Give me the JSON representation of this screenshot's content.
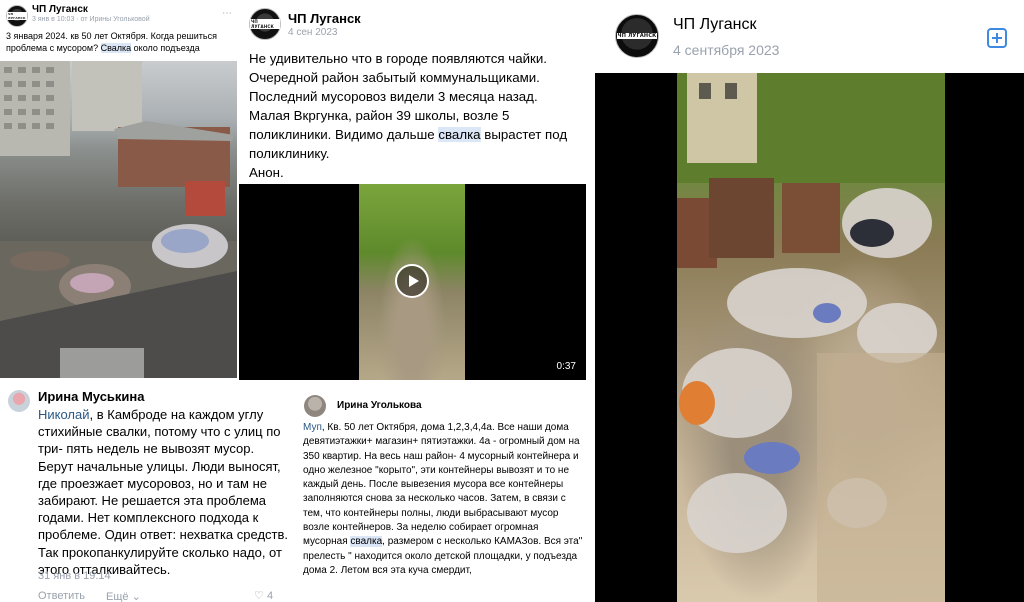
{
  "colors": {
    "link": "#2a5885",
    "highlight": "#dbe7f6",
    "meta": "#99a2ad"
  },
  "panel_a": {
    "author": "ЧП Луганск",
    "meta": "3 янв в 10:03 · от Ирины Угольковой",
    "text_before": "3 января 2024. кв 50 лет Октября. Когда решиться проблема с мусором? ",
    "text_highlight": "Свалка",
    "text_after": " около подъезда",
    "avatar_text": "ЧП ЛУГАНСК"
  },
  "panel_b": {
    "author": "ЧП Луганск",
    "date": "4 сен 2023",
    "text_before": "Не удивительно что в городе появляются чайки. Очередной район забытый коммунальщиками. Последний мусоровоз видели 3 месяца назад. Малая Вкргунка, район 39 школы, возле 5 поликлиники. Видимо дальше ",
    "text_highlight": "свалка",
    "text_after": " вырастет под поликлинику.",
    "text_sign": "Анон.",
    "video_duration": "0:37",
    "avatar_text": "ЧП ЛУГАНСК"
  },
  "panel_c": {
    "author": "ЧП Луганск",
    "date": "4 сентября 2023",
    "add_icon": "plus-square-icon",
    "avatar_text": "ЧП ЛУГАНСК"
  },
  "panel_d": {
    "author": "Ирина Муськина",
    "mention": "Николай",
    "text": ", в Камброде на каждом углу стихийные свалки, потому что с улиц по три- пять недель не вывозят мусор. Берут начальные улицы. Люди выносят, где проезжает мусоровоз, но и там не забирают. Не решается эта проблема годами. Нет комплексного подхода к проблеме. Один ответ: нехватка средств. Так прокопанкулируйте сколько надо, от этого отталкивайтесь.",
    "time": "31 янв в 19:14",
    "reply": "Ответить",
    "more": "Ещё",
    "likes": "4"
  },
  "panel_e": {
    "author": "Ирина Уголькова",
    "mention": "Муп",
    "text_before": ", Кв. 50 лет Октября, дома 1,2,3,4,4а. Все наши дома девятиэтажки+ магазин+ пятиэтажки. 4а - огромный дом на 350 квартир. На весь наш район- 4 мусорный контейнера и одно железное \"корыто\", эти контейнеры вывозят и то не каждый день. После вывезения мусора все контейнеры заполняются снова за несколько часов. Затем, в связи с тем, что контейнеры полны, люди выбрасывают мусор возле контейнеров. За неделю собирает огромная мусорная ",
    "text_highlight": "свалка",
    "text_after": ", размером с несколько КАМАЗов. Вся эта\" прелесть \" находится около детской площадки, у подъезда дома 2. Летом вся эта куча смердит,"
  }
}
